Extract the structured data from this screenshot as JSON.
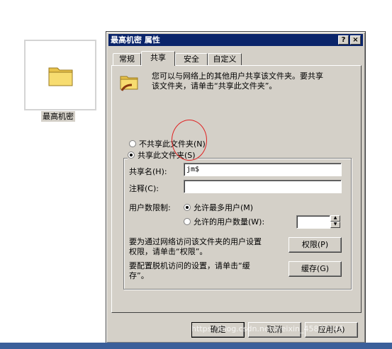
{
  "desktop": {
    "folder_label": "最高机密"
  },
  "dialog": {
    "title": "最高机密 属性",
    "help_btn": "?",
    "close_btn": "×",
    "tabs": [
      {
        "label": "常规"
      },
      {
        "label": "共享"
      },
      {
        "label": "安全"
      },
      {
        "label": "自定义"
      }
    ],
    "active_tab": "共享",
    "intro_line1": "您可以与网络上的其他用户共享该文件夹。要共享",
    "intro_line2": "该文件夹，请单击“共享此文件夹”。",
    "radio_no_share": "不共享此文件夹(N)",
    "radio_share": "共享此文件夹(S)",
    "share_name_label": "共享名(H):",
    "share_name_value": "jm$",
    "comment_label": "注释(C):",
    "comment_value": "",
    "user_limit_label": "用户数限制:",
    "radio_max_users": "允许最多用户(M)",
    "radio_allowed_users": "允许的用户数量(W):",
    "allowed_users_value": "",
    "permissions_text_1": "要为通过网络访问该文件夹的用户设置",
    "permissions_text_2": "权限，请单击“权限”。",
    "permissions_btn": "权限(P)",
    "caching_text_1": "要配置脱机访问的设置，请单击“缓",
    "caching_text_2": "存”。",
    "caching_btn": "缓存(G)",
    "ok_btn": "确定",
    "cancel_btn": "取消",
    "apply_btn": "应用(A)"
  },
  "watermark": "https://blog.csdn.net/weixin_45877148",
  "colors": {
    "titlebar": "#0a246a",
    "face": "#d4d0c8",
    "annotation": "#e02020"
  }
}
